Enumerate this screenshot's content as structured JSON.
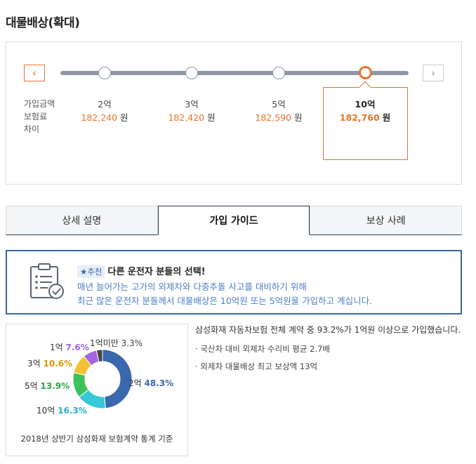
{
  "page": {
    "title": "대물배상(확대)"
  },
  "slider": {
    "prev_label": "‹",
    "next_label": "›",
    "row_labels": [
      "가입금액",
      "보험료",
      "차이"
    ],
    "won_unit": "원",
    "options": [
      {
        "amount": "2억",
        "price": "182,240"
      },
      {
        "amount": "3억",
        "price": "182,420"
      },
      {
        "amount": "5억",
        "price": "182,590"
      },
      {
        "amount": "10억",
        "price": "182,760"
      }
    ],
    "selected_index": 3
  },
  "tabs": [
    {
      "label": "상세 설명"
    },
    {
      "label": "가입 가이드"
    },
    {
      "label": "보상 사례"
    }
  ],
  "recommend": {
    "badge": "추천",
    "title": "다른 운전자 분들의 선택!",
    "line1": "매년 늘어가는 고가의 외제차와 다중추돌 사고를 대비하기 위해",
    "line2": "최근 많은 운전자 분들께서 대물배상은 10억원 또는 5억원을 가입하고 계십니다."
  },
  "chart_data": {
    "type": "pie",
    "variant": "donut",
    "slices": [
      {
        "label": "2억",
        "value": 48.3,
        "value_text": "48.3%",
        "color": "#3a67ad"
      },
      {
        "label": "10억",
        "value": 16.3,
        "value_text": "16.3%",
        "color": "#37c9d9"
      },
      {
        "label": "5억",
        "value": 13.9,
        "value_text": "13.9%",
        "color": "#3cc25a"
      },
      {
        "label": "3억",
        "value": 10.6,
        "value_text": "10.6%",
        "color": "#f2c232"
      },
      {
        "label": "1억",
        "value": 7.6,
        "value_text": "7.6%",
        "color": "#a365e0"
      },
      {
        "label": "1억미만",
        "value": 3.3,
        "value_text": "3.3%",
        "color": "#444444"
      }
    ],
    "caption": "2018년 상반기 삼성화재 보험계약 통계 기준"
  },
  "stats": {
    "main": "삼성화재 자동차보험 전체 계약 중 93.2%가 1억원 이상으로 가입했습니다.",
    "bullets": [
      "· 국산차 대비 외제차 수리비 평균 2.7배",
      "· 외제차 대물배상 최고 보상액 13억"
    ]
  },
  "colors": {
    "accent": "#e8732a",
    "primary": "#3a66a6",
    "track": "#8e97a4"
  }
}
